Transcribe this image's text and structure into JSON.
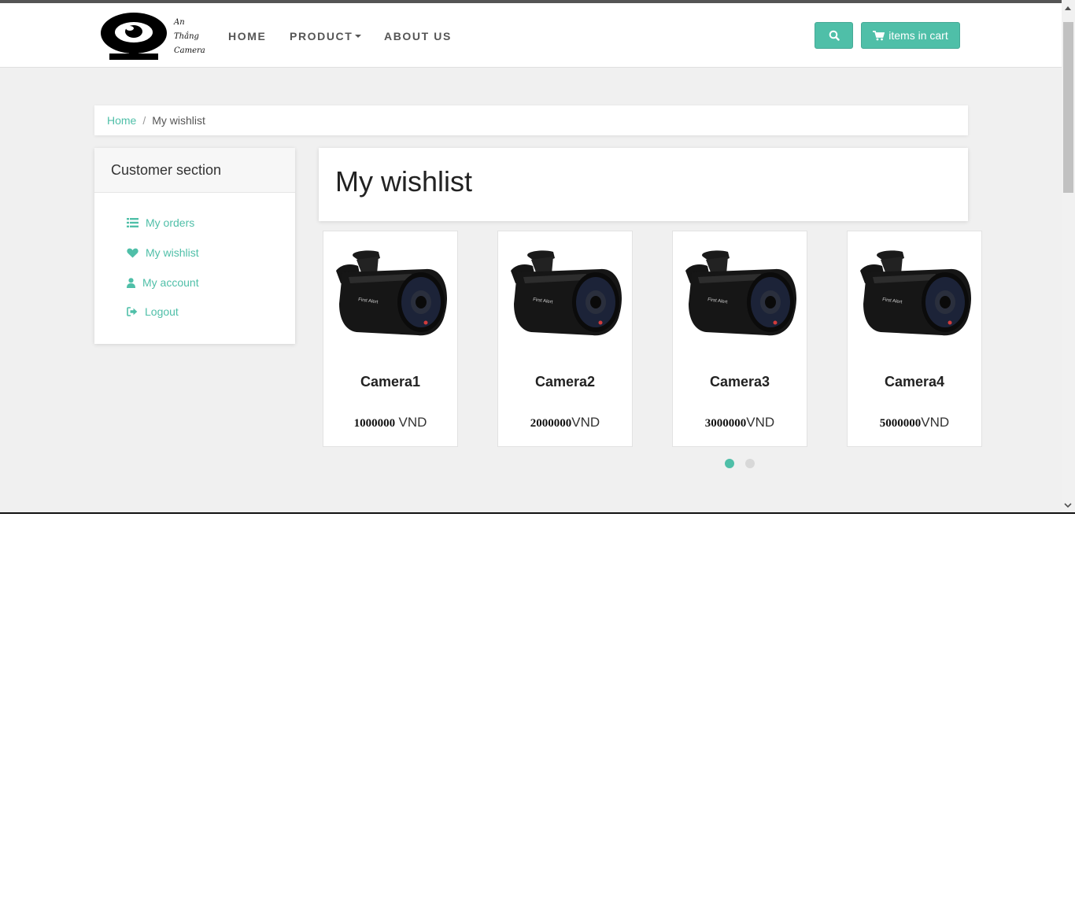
{
  "brand": {
    "logo_text_line1": "An",
    "logo_text_line2": "Thắng",
    "logo_text_line3": "Camera"
  },
  "nav": {
    "home": "HOME",
    "product": "PRODUCT",
    "about": "ABOUT US",
    "cart_label": "items in cart"
  },
  "breadcrumb": {
    "home": "Home",
    "separator": "/",
    "current": "My wishlist"
  },
  "sidebar": {
    "title": "Customer section",
    "items": [
      {
        "label": "My orders",
        "icon": "list-icon"
      },
      {
        "label": "My wishlist",
        "icon": "heart-icon"
      },
      {
        "label": "My account",
        "icon": "user-icon"
      },
      {
        "label": "Logout",
        "icon": "sign-out-icon"
      }
    ]
  },
  "main": {
    "title": "My wishlist",
    "products": [
      {
        "name": "Camera1",
        "price": "1000000",
        "unit": "VND"
      },
      {
        "name": "Camera2",
        "price": "2000000",
        "unit": "VND"
      },
      {
        "name": "Camera3",
        "price": "3000000",
        "unit": "VND"
      },
      {
        "name": "Camera4",
        "price": "5000000",
        "unit": "VND"
      }
    ],
    "carousel_pages": 2,
    "carousel_active": 1
  },
  "colors": {
    "accent": "#4fbfa8",
    "background": "#f0f0f0"
  }
}
